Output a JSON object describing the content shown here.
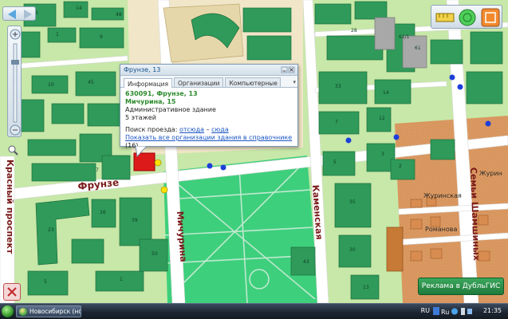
{
  "popup": {
    "title": "Фрунзе, 13",
    "tabs": [
      "Информация",
      "Организации",
      "Компьютерные ..."
    ],
    "tabs_more": "▾",
    "address_line1": "630091, Фрунзе, 13",
    "address_line2": "Мичурина, 15",
    "building_type": "Административное здание",
    "floors": "5 этажей",
    "route_label": "Поиск проезда:",
    "route_from": "отсюда",
    "route_dash": "–",
    "route_to": "сюда",
    "show_all_link": "Показать все организации здания в справочнике",
    "show_all_count": "(16)"
  },
  "streets": {
    "frunze": "Фрунзе",
    "michurina": "Мичурина",
    "kamenskaya": "Каменская",
    "krasny_prospekt": "Красный проспект",
    "zhurinskaya": "Журинская",
    "zhurinskaya_short": "Журин",
    "romanova": "Романова",
    "semi_shamshinykh": "Семьи Шамшиных"
  },
  "building_numbers": [
    "14",
    "48",
    "13",
    "1",
    "9",
    "10",
    "45",
    "28",
    "61/1",
    "61",
    "33",
    "14",
    "7",
    "12",
    "5",
    "35",
    "3",
    "30",
    "13",
    "43",
    "23",
    "16",
    "39",
    "5",
    "1",
    "50",
    "7",
    "2"
  ],
  "ad_label": "Реклама в ДубльГИС",
  "taskbar": {
    "item_label": "Новосибирск (нов...",
    "lang": "RU",
    "lang2": "Ru",
    "clock": "21:35"
  },
  "colors": {
    "background": "#c7e8a8",
    "building": "#2f9a5a",
    "park": "#3ecf7c",
    "road": "#ffffff",
    "street_label": "#7a1a1a",
    "selected_building": "#dd1a1a",
    "info_link": "#1a55c4"
  },
  "icons": [
    "back-icon",
    "forward-icon",
    "zoom-in-icon",
    "zoom-out-icon",
    "zoom-slider-icon",
    "search-magnifier-icon",
    "ruler-icon",
    "globe-icon",
    "measure-icon",
    "close-icon",
    "minimize-icon",
    "windows-start-icon"
  ]
}
